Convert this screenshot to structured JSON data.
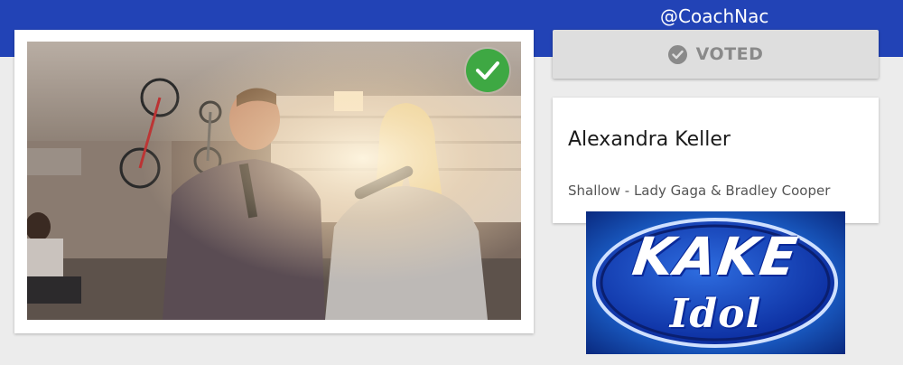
{
  "header": {
    "handle": "@CoachNac",
    "background_color": "#2243b6"
  },
  "video": {
    "description_icon": "video-thumbnail",
    "voted_check_icon": "checkmark-circle-icon",
    "check_color": "#3ea843"
  },
  "vote": {
    "label": "VOTED",
    "icon": "check-circle-icon"
  },
  "contestant": {
    "name": "Alexandra Keller",
    "song": "Shallow - Lady Gaga & Bradley Cooper"
  },
  "logo": {
    "line1": "KAKE",
    "line2": "Idol"
  }
}
